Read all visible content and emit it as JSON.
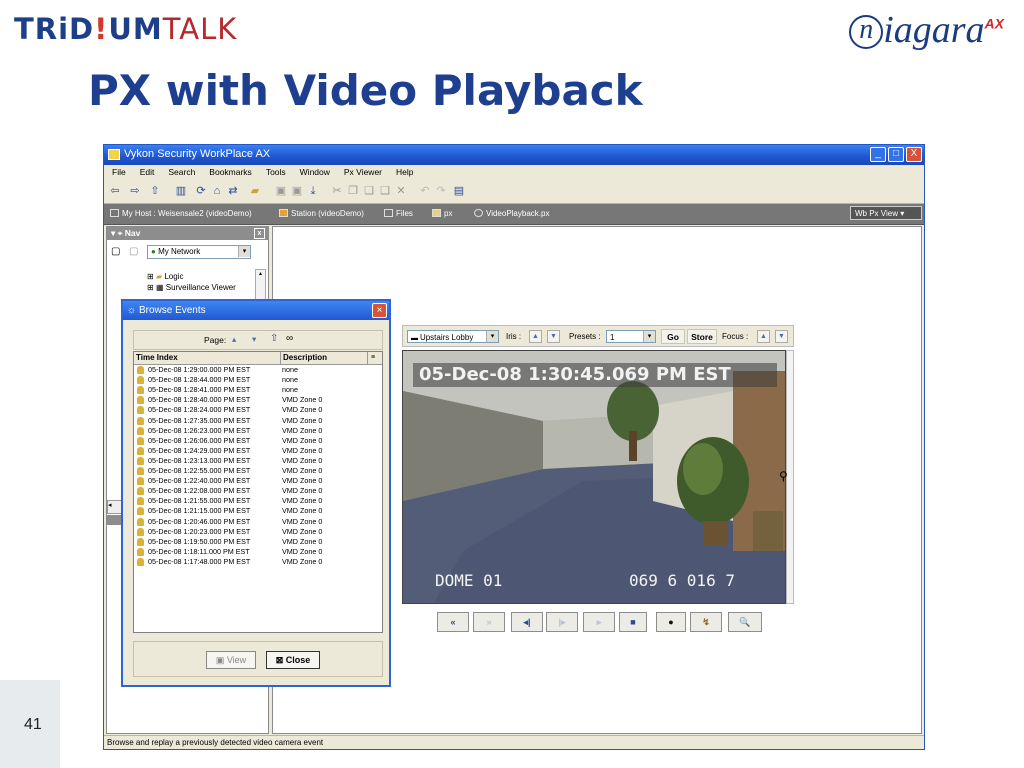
{
  "slide": {
    "logo_left_a": "TRiD",
    "logo_left_dot": "!",
    "logo_left_b": "UM",
    "logo_left_c": "TALK",
    "logo_right_n": "n",
    "logo_right_rest": "iagara",
    "logo_right_sup": "AX",
    "title": "PX with Video Playback",
    "slide_number": "41"
  },
  "window": {
    "title": "Vykon Security WorkPlace AX",
    "controls": [
      "_",
      "□",
      "X"
    ],
    "menu": [
      "File",
      "Edit",
      "Search",
      "Bookmarks",
      "Tools",
      "Window",
      "Px Viewer",
      "Help"
    ],
    "toolbar_icons": [
      "back-arrow-icon",
      "forward-arrow-icon",
      "up-level-icon",
      "view-icon",
      "refresh-icon",
      "home-icon",
      "sync-icon",
      "folder-icon",
      "save-icon",
      "save-all-icon",
      "export-icon",
      "cut-icon",
      "copy-icon",
      "paste-icon",
      "duplicate-icon",
      "delete-icon",
      "undo-icon",
      "redo-icon",
      "properties-icon"
    ],
    "breadcrumbs": [
      "My Host : Weisensale2 (videoDemo)",
      "Station (videoDemo)",
      "Files",
      "px",
      "VideoPlayback.px"
    ],
    "view_selector": "Wb Px View",
    "status": "Browse and replay a previously detected video camera event"
  },
  "nav": {
    "title": "Nav",
    "network_select": "My Network",
    "tree": [
      "Logic",
      "Surveillance Viewer"
    ]
  },
  "video": {
    "camera_select": "Upstairs Lobby",
    "iris_label": "Iris :",
    "presets_label": "Presets :",
    "preset_value": "1",
    "go_label": "Go",
    "store_label": "Store",
    "focus_label": "Focus :",
    "timestamp": "05-Dec-08 1:30:45.069 PM EST",
    "camera_id": "DOME 01",
    "camera_code": "069 6 016 7",
    "playback_controls": [
      "«",
      "»",
      "◂|",
      "|▸",
      "▸",
      "■",
      "●",
      "↯",
      "🔍"
    ]
  },
  "dialog": {
    "title": "Browse Events",
    "page_label": "Page:",
    "columns": [
      "Time Index",
      "Description"
    ],
    "events": [
      {
        "time": "05-Dec-08 1:29:00.000 PM EST",
        "desc": "none"
      },
      {
        "time": "05-Dec-08 1:28:44.000 PM EST",
        "desc": "none"
      },
      {
        "time": "05-Dec-08 1:28:41.000 PM EST",
        "desc": "none"
      },
      {
        "time": "05-Dec-08 1:28:40.000 PM EST",
        "desc": "VMD Zone 0"
      },
      {
        "time": "05-Dec-08 1:28:24.000 PM EST",
        "desc": "VMD Zone 0"
      },
      {
        "time": "05-Dec-08 1:27:35.000 PM EST",
        "desc": "VMD Zone 0"
      },
      {
        "time": "05-Dec-08 1:26:23.000 PM EST",
        "desc": "VMD Zone 0"
      },
      {
        "time": "05-Dec-08 1:26:06.000 PM EST",
        "desc": "VMD Zone 0"
      },
      {
        "time": "05-Dec-08 1:24:29.000 PM EST",
        "desc": "VMD Zone 0"
      },
      {
        "time": "05-Dec-08 1:23:13.000 PM EST",
        "desc": "VMD Zone 0"
      },
      {
        "time": "05-Dec-08 1:22:55.000 PM EST",
        "desc": "VMD Zone 0"
      },
      {
        "time": "05-Dec-08 1:22:40.000 PM EST",
        "desc": "VMD Zone 0"
      },
      {
        "time": "05-Dec-08 1:22:08.000 PM EST",
        "desc": "VMD Zone 0"
      },
      {
        "time": "05-Dec-08 1:21:55.000 PM EST",
        "desc": "VMD Zone 0"
      },
      {
        "time": "05-Dec-08 1:21:15.000 PM EST",
        "desc": "VMD Zone 0"
      },
      {
        "time": "05-Dec-08 1:20:46.000 PM EST",
        "desc": "VMD Zone 0"
      },
      {
        "time": "05-Dec-08 1:20:23.000 PM EST",
        "desc": "VMD Zone 0"
      },
      {
        "time": "05-Dec-08 1:19:50.000 PM EST",
        "desc": "VMD Zone 0"
      },
      {
        "time": "05-Dec-08 1:18:11.000 PM EST",
        "desc": "VMD Zone 0"
      },
      {
        "time": "05-Dec-08 1:17:48.000 PM EST",
        "desc": "VMD Zone 0"
      }
    ],
    "view_label": "View",
    "close_label": "Close"
  }
}
